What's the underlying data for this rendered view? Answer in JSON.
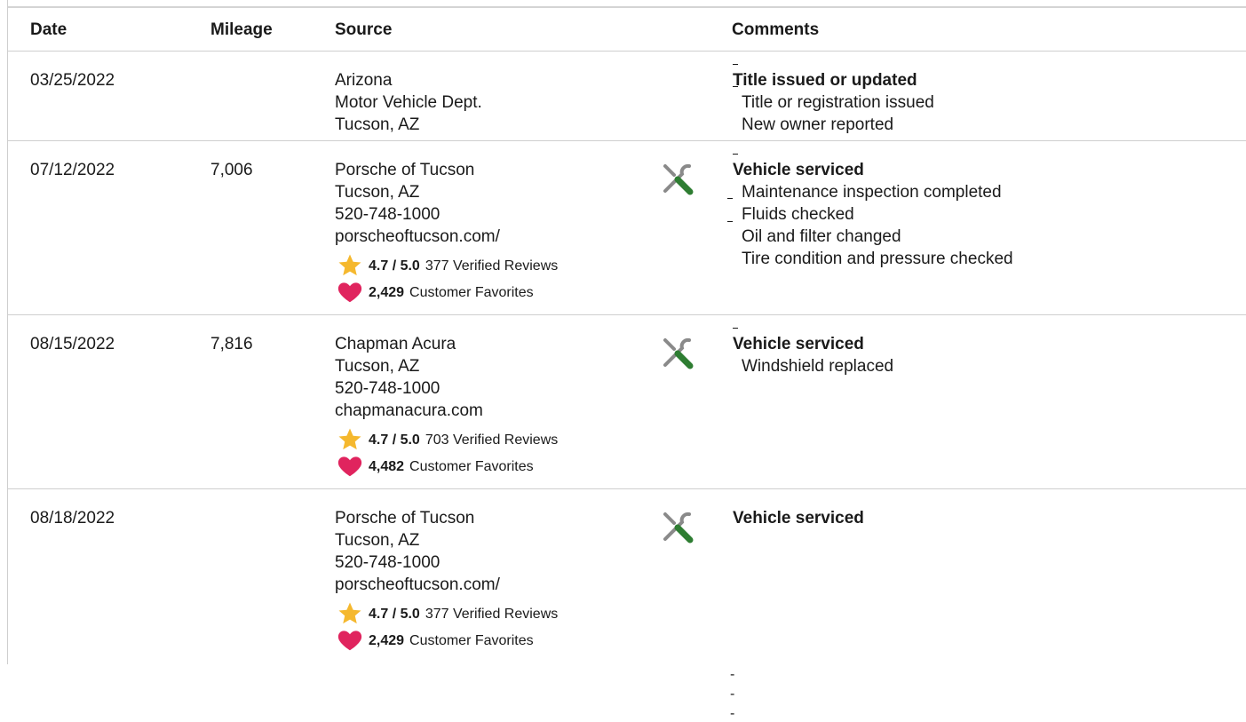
{
  "header": {
    "date": "Date",
    "mileage": "Mileage",
    "source": "Source",
    "comments": "Comments"
  },
  "rows": [
    {
      "date": "03/25/2022",
      "mileage": "",
      "source": [
        "Arizona",
        "Motor Vehicle Dept.",
        "Tucson, AZ"
      ],
      "comment_title": "Title issued or updated",
      "comment_items": [
        "Title or registration issued",
        "New owner reported"
      ]
    },
    {
      "date": "07/12/2022",
      "mileage": "7,006",
      "source": [
        "Porsche of Tucson",
        "Tucson, AZ",
        "520-748-1000",
        "porscheoftucson.com/"
      ],
      "rating": "4.7 / 5.0",
      "reviews": "377 Verified Reviews",
      "favorites_count": "2,429",
      "favorites_label": "Customer Favorites",
      "comment_title": "Vehicle serviced",
      "comment_items": [
        "Maintenance inspection completed",
        "Fluids checked",
        "Oil and filter changed",
        "Tire condition and pressure checked"
      ]
    },
    {
      "date": "08/15/2022",
      "mileage": "7,816",
      "source": [
        "Chapman Acura",
        "Tucson, AZ",
        "520-748-1000",
        "chapmanacura.com"
      ],
      "rating": "4.7 / 5.0",
      "reviews": "703 Verified Reviews",
      "favorites_count": "4,482",
      "favorites_label": "Customer Favorites",
      "comment_title": "Vehicle serviced",
      "comment_items": [
        "Windshield replaced"
      ]
    },
    {
      "date": "08/18/2022",
      "mileage": "",
      "source": [
        "Porsche of Tucson",
        "Tucson, AZ",
        "520-748-1000",
        "porscheoftucson.com/"
      ],
      "rating": "4.7 / 5.0",
      "reviews": "377 Verified Reviews",
      "favorites_count": "2,429",
      "favorites_label": "Customer Favorites",
      "comment_title": "Vehicle serviced",
      "comment_items": []
    }
  ],
  "trailing_dashes": [
    "-",
    "-",
    "-"
  ],
  "icons": {
    "service": "wrench-screwdriver-icon",
    "rating": "star-icon",
    "favorites": "heart-icon"
  },
  "colors": {
    "star": "#f5b82e",
    "heart": "#e0245e",
    "screwdriver_handle": "#2e7d32",
    "tool_gray": "#8a8a8a",
    "divider": "#cfcfcf"
  }
}
